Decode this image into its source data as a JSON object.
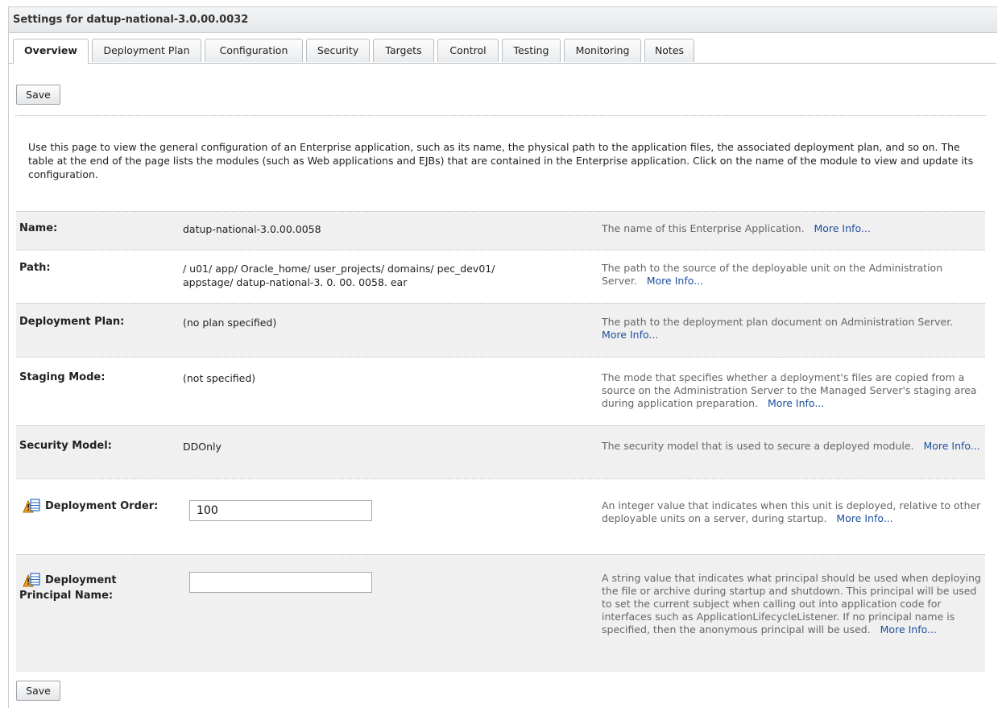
{
  "header": {
    "title": "Settings for datup-national-3.0.00.0032"
  },
  "tabs": [
    {
      "label": "Overview",
      "active": true
    },
    {
      "label": "Deployment Plan"
    },
    {
      "label": "Configuration"
    },
    {
      "label": "Security"
    },
    {
      "label": "Targets"
    },
    {
      "label": "Control"
    },
    {
      "label": "Testing"
    },
    {
      "label": "Monitoring"
    },
    {
      "label": "Notes"
    }
  ],
  "buttons": {
    "save_top": "Save",
    "save_bottom": "Save"
  },
  "intro": "Use this page to view the general configuration of an Enterprise application, such as its name, the physical path to the application files, the associated deployment plan, and so on. The table at the end of the page lists the modules (such as Web applications and EJBs) that are contained in the Enterprise application. Click on the name of the module to view and update its configuration.",
  "more_info": "More Info...",
  "fields": {
    "name": {
      "label": "Name:",
      "value": "datup-national-3.0.00.0058",
      "help": "The name of this Enterprise Application."
    },
    "path": {
      "label": "Path:",
      "value_line1": "/ u01/ app/ Oracle_home/ user_projects/ domains/ pec_dev01/",
      "value_line2": "appstage/ datup-national-3. 0. 00. 0058. ear",
      "help": "The path to the source of the deployable unit on the Administration Server."
    },
    "deployment_plan": {
      "label": "Deployment Plan:",
      "value": "(no plan specified)",
      "help": "The path to the deployment plan document on Administration Server."
    },
    "staging_mode": {
      "label": "Staging Mode:",
      "value": "(not specified)",
      "help": "The mode that specifies whether a deployment's files are copied from a source on the Administration Server to the Managed Server's staging area during application preparation."
    },
    "security_model": {
      "label": "Security Model:",
      "value": "DDOnly",
      "help": "The security model that is used to secure a deployed module."
    },
    "deployment_order": {
      "label": "Deployment Order:",
      "value": "100",
      "help": "An integer value that indicates when this unit is deployed, relative to other deployable units on a server, during startup."
    },
    "principal_name": {
      "label_line1": "Deployment",
      "label_line2": "Principal Name:",
      "value": "",
      "help": "A string value that indicates what principal should be used when deploying the file or archive during startup and shutdown. This principal will be used to set the current subject when calling out into application code for interfaces such as ApplicationLifecycleListener. If no principal name is specified, then the anonymous principal will be used."
    }
  },
  "icons": {
    "config_change": "config-change-warning-icon"
  },
  "colors": {
    "link": "#1b4f9c",
    "row_shade": "#f0f0f0",
    "help_text": "#666666",
    "icon_orange": "#f0a020"
  }
}
